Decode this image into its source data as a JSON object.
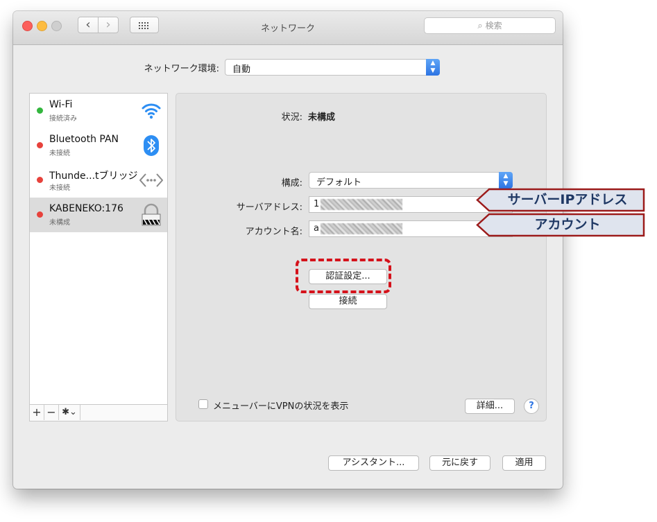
{
  "window": {
    "title": "ネットワーク",
    "search_placeholder": "検索"
  },
  "location": {
    "label": "ネットワーク環境:",
    "value": "自動"
  },
  "services": [
    {
      "name": "Wi-Fi",
      "status": "接続済み",
      "status_color": "#33b63e",
      "icon": "wifi-icon"
    },
    {
      "name": "Bluetooth PAN",
      "status": "未接続",
      "status_color": "#e7423c",
      "icon": "bluetooth-icon"
    },
    {
      "name": "Thunde...tブリッジ",
      "status": "未接続",
      "status_color": "#e7423c",
      "icon": "thunderbolt-bridge-icon"
    },
    {
      "name": "KABENEKO:176",
      "status": "未構成",
      "status_color": "#e7423c",
      "icon": "vpn-lock-icon",
      "selected": true
    }
  ],
  "sidebar_toolbar": {
    "add": "+",
    "remove": "−",
    "gear": "✱⌄"
  },
  "detail": {
    "status_label": "状況:",
    "status_value": "未構成",
    "config_label": "構成:",
    "config_value": "デフォルト",
    "server_label": "サーバアドレス:",
    "server_value": "1",
    "account_label": "アカウント名:",
    "account_value": "a",
    "auth_button": "認証設定...",
    "connect_button": "接続",
    "vpn_menu_label": "メニューバーにVPNの状況を表示",
    "advanced_button": "詳細...",
    "help_button": "?"
  },
  "footer": {
    "assistant_button": "アシスタント...",
    "revert_button": "元に戻す",
    "apply_button": "適用"
  },
  "callouts": {
    "server": "サーバーIPアドレス",
    "account": "アカウント"
  },
  "colors": {
    "accent": "#2d74e3",
    "highlight_red": "#d5121b",
    "callout_border": "#9c1b1b",
    "callout_fill": "#dfe4ee",
    "callout_text": "#1f3864"
  }
}
